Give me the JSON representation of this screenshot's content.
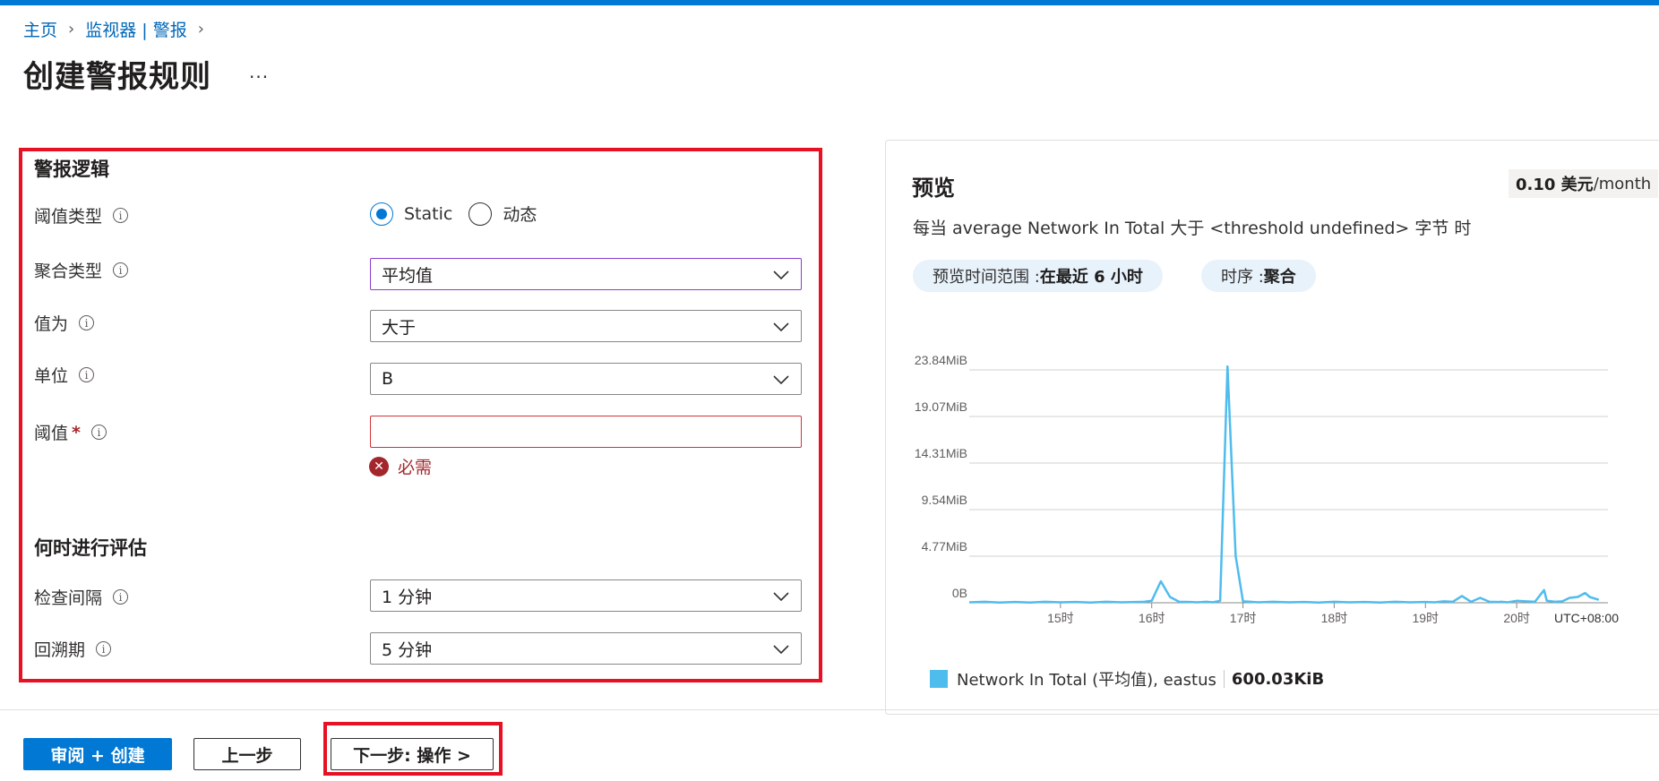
{
  "breadcrumb": {
    "home": "主页",
    "monitor": "监视器 | 警报"
  },
  "page": {
    "title": "创建警报规则",
    "more": "..."
  },
  "form": {
    "section_logic": "警报逻辑",
    "threshold_type_label": "阈值类型",
    "radio_static": "Static",
    "radio_dynamic": "动态",
    "aggregation_label": "聚合类型",
    "aggregation_value": "平均值",
    "operator_label": "值为",
    "operator_value": "大于",
    "unit_label": "单位",
    "unit_value": "B",
    "threshold_label": "阈值",
    "threshold_required_mark": "*",
    "threshold_value": "",
    "error_text": "必需",
    "section_eval": "何时进行评估",
    "check_interval_label": "检查间隔",
    "check_interval_value": "1 分钟",
    "lookback_label": "回溯期",
    "lookback_value": "5 分钟"
  },
  "preview": {
    "title": "预览",
    "cost_amount": "0.10 美元",
    "cost_unit": "/month",
    "condition": "每当 average Network In Total 大于 <threshold undefined> 字节 时",
    "range_label": "预览时间范围 : ",
    "range_value": "在最近 6 小时",
    "series_label": "时序 : ",
    "series_value": "聚合"
  },
  "chart_data": {
    "type": "line",
    "y_ticks": [
      "0B",
      "4.77MiB",
      "9.54MiB",
      "14.31MiB",
      "19.07MiB",
      "23.84MiB"
    ],
    "x_ticks": [
      "15时",
      "16时",
      "17时",
      "18时",
      "19时",
      "20时"
    ],
    "timezone_label": "UTC+08:00",
    "ylim": [
      0,
      23.84
    ],
    "x": [
      14.0,
      14.17,
      14.33,
      14.5,
      14.67,
      14.83,
      15.0,
      15.17,
      15.33,
      15.5,
      15.67,
      15.83,
      15.92,
      16.0,
      16.1,
      16.2,
      16.3,
      16.42,
      16.5,
      16.6,
      16.67,
      16.75,
      16.83,
      16.92,
      17.0,
      17.17,
      17.33,
      17.5,
      17.67,
      17.83,
      18.0,
      18.17,
      18.33,
      18.5,
      18.67,
      18.83,
      19.0,
      19.1,
      19.2,
      19.3,
      19.4,
      19.5,
      19.6,
      19.7,
      19.8,
      19.83,
      19.9,
      20.0,
      20.1,
      20.2,
      20.3,
      20.33,
      20.42,
      20.5,
      20.58,
      20.67,
      20.75,
      20.8,
      20.9
    ],
    "y": [
      0.05,
      0.1,
      0.03,
      0.08,
      0.02,
      0.1,
      0.05,
      0.08,
      0.03,
      0.1,
      0.05,
      0.08,
      0.1,
      0.2,
      2.2,
      0.6,
      0.1,
      0.08,
      0.05,
      0.1,
      0.05,
      0.2,
      24.2,
      4.8,
      0.15,
      0.05,
      0.1,
      0.05,
      0.08,
      0.03,
      0.1,
      0.05,
      0.08,
      0.03,
      0.1,
      0.05,
      0.08,
      0.05,
      0.15,
      0.1,
      0.7,
      0.1,
      0.5,
      0.1,
      0.08,
      0.1,
      0.05,
      0.2,
      0.15,
      0.1,
      1.3,
      0.2,
      0.1,
      0.15,
      0.5,
      0.6,
      1.0,
      0.6,
      0.3
    ],
    "series": [
      {
        "name": "Network In Total (平均值), eastus",
        "summary": "600.03KiB",
        "color": "#4fbcee"
      }
    ]
  },
  "footer": {
    "review_create": "审阅 + 创建",
    "previous": "上一步",
    "next": "下一步: 操作 >"
  }
}
